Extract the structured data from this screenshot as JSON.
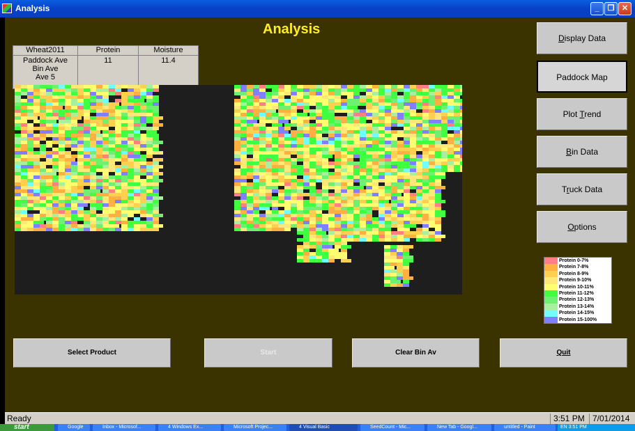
{
  "window": {
    "title": "Analysis"
  },
  "page_title": "Analysis",
  "info_table": {
    "headers": [
      "Wheat2011",
      "Protein",
      "Moisture"
    ],
    "row_label_lines": [
      "Paddock Ave",
      "Bin Ave",
      "Ave 5"
    ],
    "protein": "11",
    "moisture": "11.4"
  },
  "side_buttons": [
    {
      "pre": "",
      "key": "D",
      "post": "isplay Data",
      "active": false
    },
    {
      "pre": "Paddock Map",
      "key": "",
      "post": "",
      "active": true
    },
    {
      "pre": "Plot ",
      "key": "T",
      "post": "rend",
      "active": false
    },
    {
      "pre": "",
      "key": "B",
      "post": "in Data",
      "active": false
    },
    {
      "pre": "T",
      "key": "r",
      "post": "uck Data",
      "active": false
    },
    {
      "pre": "",
      "key": "O",
      "post": "ptions",
      "active": false
    }
  ],
  "legend": [
    {
      "label": "Protein 0-7%",
      "color": "#ff8080"
    },
    {
      "label": "Protein 7-8%",
      "color": "#ffb040"
    },
    {
      "label": "Protein 8-9%",
      "color": "#ffd050"
    },
    {
      "label": "Protein 9-10%",
      "color": "#ffe878"
    },
    {
      "label": "Protein 10-11%",
      "color": "#ffff70"
    },
    {
      "label": "Protein 11-12%",
      "color": "#40ff40"
    },
    {
      "label": "Protein 12-13%",
      "color": "#70f070"
    },
    {
      "label": "Protein 13-14%",
      "color": "#a8f0a0"
    },
    {
      "label": "Protein 14-15%",
      "color": "#70ffff"
    },
    {
      "label": "Protein 15-100%",
      "color": "#8080ff"
    }
  ],
  "bottom_buttons": {
    "select_product": "Select Product",
    "start": "Start",
    "clear_bin": "Clear Bin Av",
    "quit": "Quit"
  },
  "status_bar": {
    "status": "Ready",
    "time": "3:51 PM",
    "date": "7/01/2014"
  },
  "taskbar": {
    "start": "start",
    "items": [
      "Google",
      "Inbox - Microsof...",
      "4 Windows Ex...",
      "Microsoft Projec...",
      "4 Visual Basic",
      "SeedCount - Mic...",
      "New Tab - Googl...",
      "untitled - Paint"
    ],
    "tray": "EN  3:51 PM"
  },
  "colors": {
    "background": "#3a3300",
    "title_text": "#ffee22",
    "map_background": "#1e1e1e",
    "button": "#c9c9c9"
  }
}
